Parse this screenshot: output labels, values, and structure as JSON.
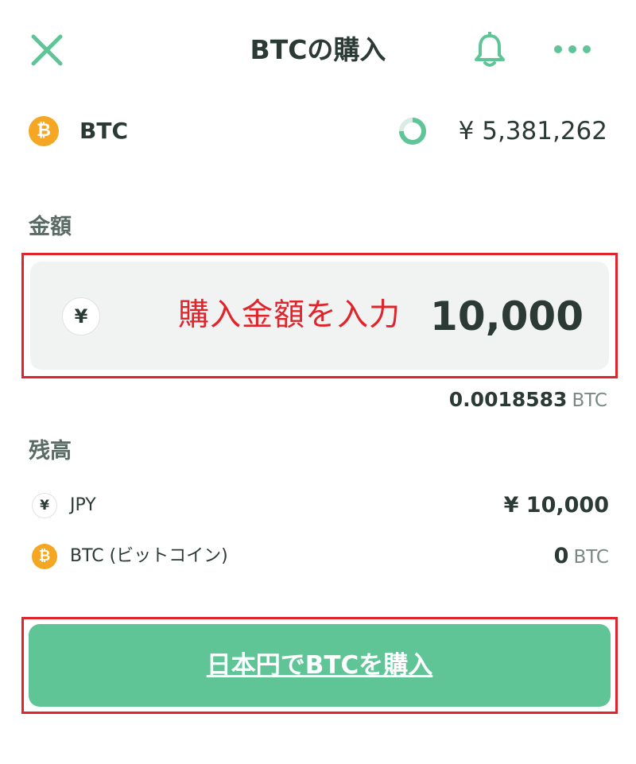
{
  "header": {
    "title": "BTCの購入"
  },
  "asset": {
    "icon_letter": "₿",
    "name": "BTC",
    "price": "¥ 5,381,262"
  },
  "amount": {
    "label": "金額",
    "currency_symbol": "¥",
    "annotation": "購入金額を入力",
    "value": "10,000",
    "btc_equivalent": "0.0018583",
    "btc_unit": "BTC"
  },
  "balance": {
    "label": "残高",
    "items": [
      {
        "icon": "¥",
        "name": "JPY",
        "value": "¥ 10,000",
        "unit": ""
      },
      {
        "icon": "₿",
        "name": "BTC (ビットコイン)",
        "value": "0",
        "unit": "BTC"
      }
    ]
  },
  "buy_button": {
    "label": "日本円でBTCを購入"
  },
  "colors": {
    "accent": "#5fc597",
    "bitcoin": "#f5a623",
    "annotation_red": "#e0242c",
    "text": "#2b3a35"
  }
}
